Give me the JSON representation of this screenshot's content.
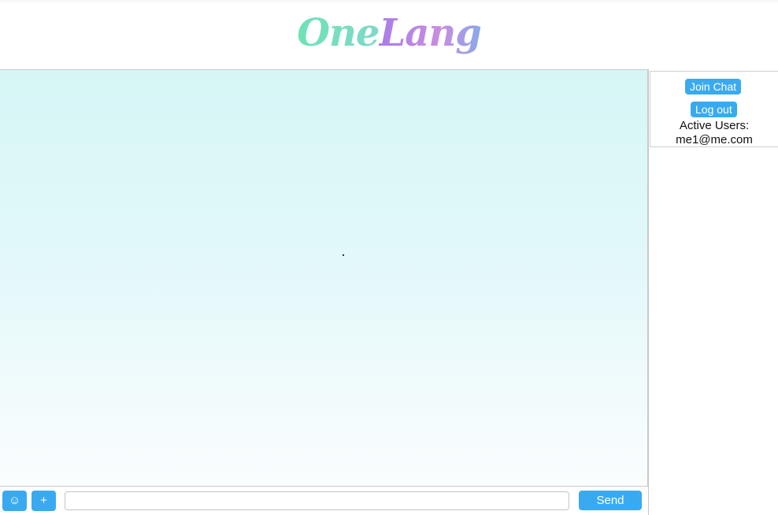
{
  "header": {
    "logo_part1": "One",
    "logo_part2": "Lang"
  },
  "sidebar": {
    "join_label": "Join Chat",
    "logout_label": "Log out",
    "active_users_label": "Active Users:",
    "active_users": [
      "me1@me.com"
    ]
  },
  "composer": {
    "emoji_icon": "smiley-icon",
    "emoji_glyph": "☺",
    "attach_icon": "plus-icon",
    "attach_glyph": "+",
    "input_value": "",
    "input_placeholder": "",
    "send_label": "Send"
  },
  "colors": {
    "accent": "#3aaaf0",
    "chat_bg_top": "#d6f6f6",
    "chat_bg_bottom": "#fbfdfe"
  }
}
